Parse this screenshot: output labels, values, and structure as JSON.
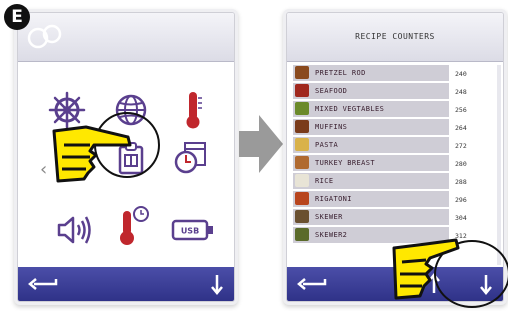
{
  "step": {
    "badge": "E"
  },
  "left_screen": {
    "icons": [
      {
        "name": "ships-wheel-icon"
      },
      {
        "name": "globe-icon"
      },
      {
        "name": "thermometer-icon"
      },
      {
        "name": "recipe-book-icon"
      },
      {
        "name": "timer-calendar-icon"
      },
      {
        "name": "volume-icon"
      },
      {
        "name": "thermometer-clock-icon"
      },
      {
        "name": "usb-icon"
      }
    ],
    "usb_label": "USB"
  },
  "right_screen": {
    "title": "RECIPE COUNTERS",
    "rows": [
      {
        "name": "PRETZEL ROD",
        "count": "240",
        "color": "#8a4a1e"
      },
      {
        "name": "SEAFOOD",
        "count": "248",
        "color": "#a0281e"
      },
      {
        "name": "MIXED VEGTABLES",
        "count": "256",
        "color": "#6b8a2a"
      },
      {
        "name": "MUFFINS",
        "count": "264",
        "color": "#7a3b1a"
      },
      {
        "name": "PASTA",
        "count": "272",
        "color": "#d9b24a"
      },
      {
        "name": "TURKEY BREAST",
        "count": "280",
        "color": "#b06a30"
      },
      {
        "name": "RICE",
        "count": "288",
        "color": "#e8e4d6"
      },
      {
        "name": "RIGATONI",
        "count": "296",
        "color": "#b8451e"
      },
      {
        "name": "SKEWER",
        "count": "304",
        "color": "#6a5030"
      },
      {
        "name": "SKEWER2",
        "count": "312",
        "color": "#5a6a2a"
      }
    ]
  },
  "colors": {
    "bottom_bar": "#3a3d96",
    "hand_fill": "#ffe800",
    "row_bg": "#cfcdd6",
    "icon_purple": "#5a3f8e",
    "icon_red": "#c0272d"
  }
}
